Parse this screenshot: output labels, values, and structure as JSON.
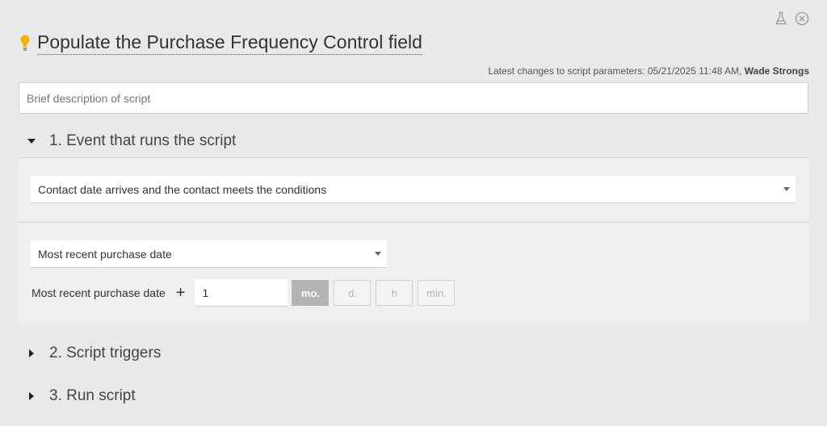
{
  "header": {
    "title": "Populate the Purchase Frequency Control field",
    "changes_prefix": "Latest changes to script parameters: 05/21/2025 11:48 AM, ",
    "changes_user": "Wade Strongs"
  },
  "description": {
    "placeholder": "Brief description of script",
    "value": ""
  },
  "sections": [
    {
      "label": "1. Event that runs the script",
      "expanded": true
    },
    {
      "label": "2. Script triggers",
      "expanded": false
    },
    {
      "label": "3. Run script",
      "expanded": false
    }
  ],
  "event": {
    "selected": "Contact date arrives and the contact meets the conditions",
    "date_field_selected": "Most recent purchase date",
    "offset_label": "Most recent purchase date",
    "plus": "+",
    "offset_value": "1",
    "units": [
      {
        "label": "mo.",
        "active": true
      },
      {
        "label": "d.",
        "active": false
      },
      {
        "label": "h",
        "active": false
      },
      {
        "label": "min.",
        "active": false
      }
    ]
  },
  "colors": {
    "background": "#e9e9e9",
    "bulb": "#f0b400",
    "active_unit": "#b3b3b3"
  },
  "icons": [
    "flask-icon",
    "close-circle-icon",
    "lightbulb-icon",
    "caret-down-icon",
    "caret-right-icon",
    "dropdown-arrow-icon"
  ]
}
